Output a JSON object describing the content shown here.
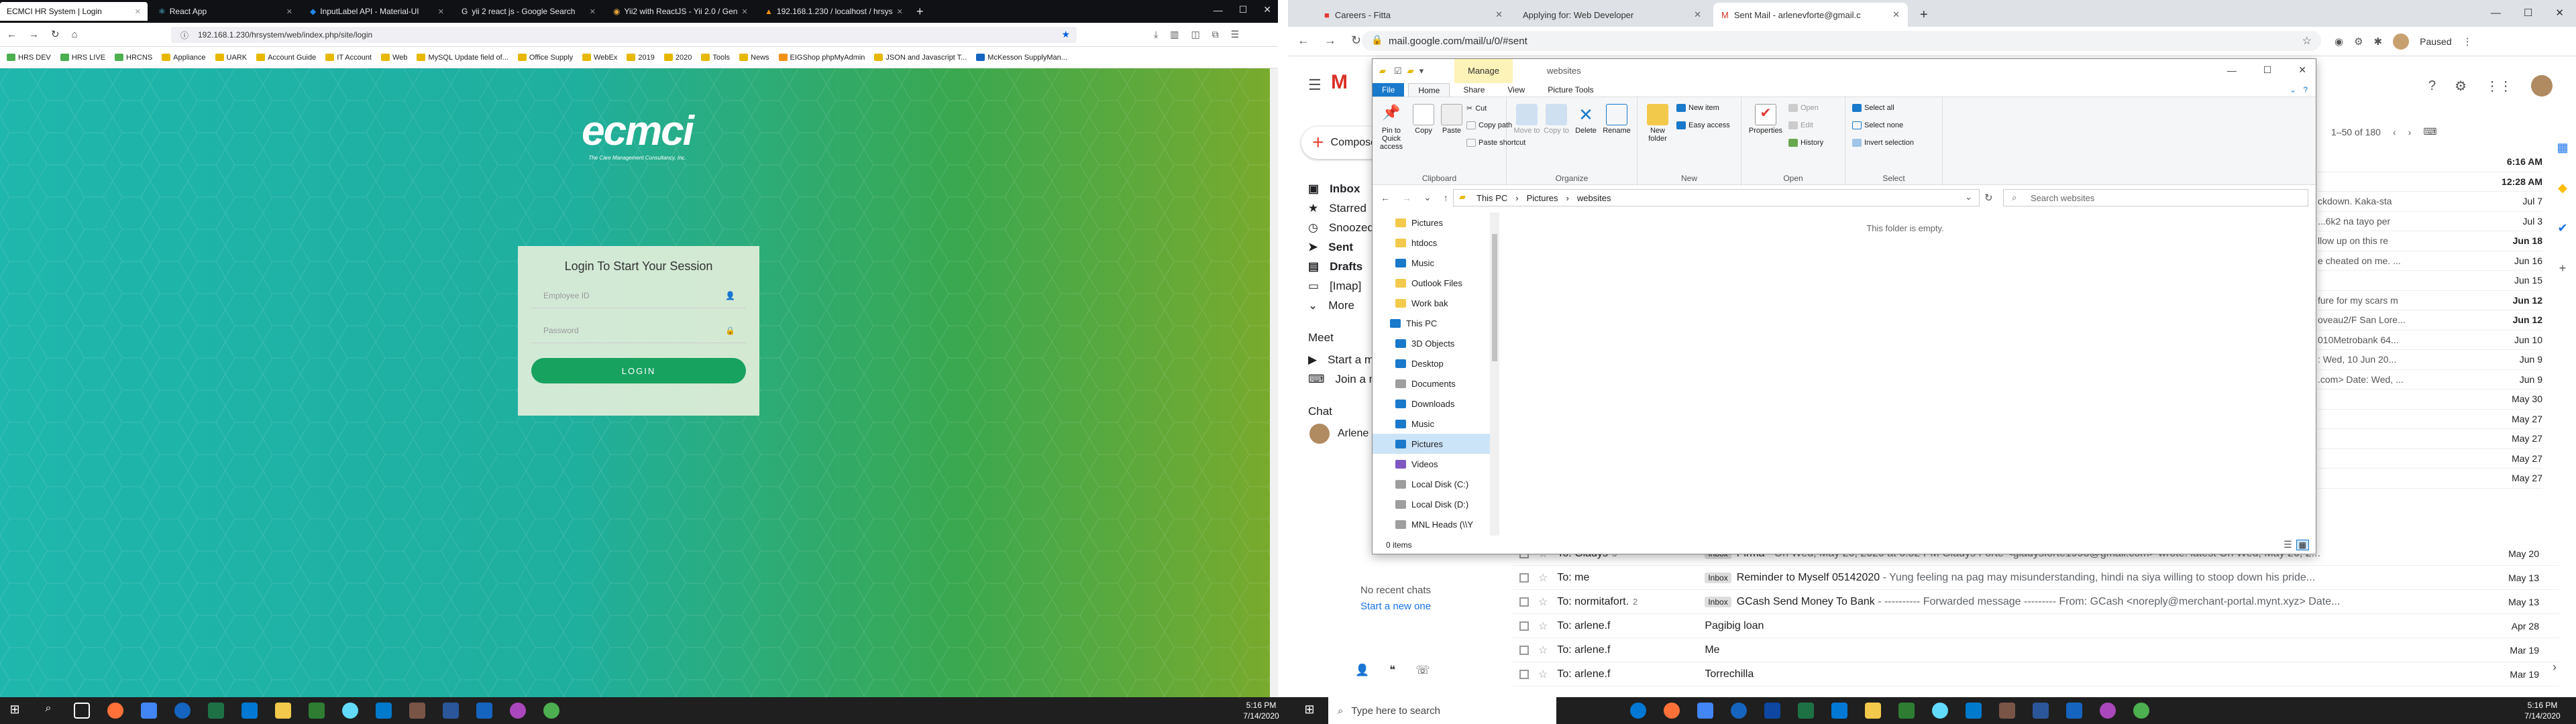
{
  "firefox": {
    "tabs": [
      {
        "label": "ECMCI HR System | Login",
        "active": true
      },
      {
        "label": "React App"
      },
      {
        "label": "InputLabel API - Material-UI"
      },
      {
        "label": "yii 2 react js - Google Search"
      },
      {
        "label": "Yii2 with ReactJS - Yii 2.0 / Gen"
      },
      {
        "label": "192.168.1.230 / localhost / hrsys"
      }
    ],
    "url": "192.168.1.230/hrsystem/web/index.php/site/login",
    "bookmarks": [
      "HRS DEV",
      "HRS LIVE",
      "HRCNS",
      "Appliance",
      "UARK",
      "Account Guide",
      "IT Account",
      "Web",
      "MySQL Update field of...",
      "Office Supply",
      "WebEx",
      "2019",
      "2020",
      "Tools",
      "News",
      "EIGShop phpMyAdmin",
      "JSON and Javascript T...",
      "McKesson SupplyMan..."
    ],
    "page": {
      "logo": "ecmci",
      "logo_tagline": "The Care Management Consultancy, Inc.",
      "login_title": "Login To Start Your Session",
      "employee_placeholder": "Employee ID",
      "password_placeholder": "Password",
      "login_button": "LOGIN"
    }
  },
  "chrome": {
    "tabs": [
      {
        "label": "Careers - Fitta"
      },
      {
        "label": "Applying for: Web Developer"
      },
      {
        "label": "Sent Mail - arlenevforte@gmail.c",
        "active": true
      }
    ],
    "url": "mail.google.com/mail/u/0/#sent",
    "profile_label": "Paused",
    "gmail": {
      "compose": "Compose",
      "nav": [
        "Inbox",
        "Starred",
        "Snoozed",
        "Sent",
        "Drafts",
        "[Imap]",
        "More"
      ],
      "meet_title": "Meet",
      "meet_items": [
        "Start a meeting",
        "Join a meeting"
      ],
      "chat_title": "Chat",
      "chat_user": "Arlene",
      "no_chats": "No recent chats",
      "start_new": "Start a new one",
      "pager": "1–50 of 180",
      "right_snippets": [
        {
          "text": "",
          "date": "6:16 AM"
        },
        {
          "text": "",
          "date": "12:28 AM"
        },
        {
          "text": "ckdown. Kaka-sta",
          "date": "Jul 7"
        },
        {
          "text": "...6k2 na tayo per",
          "date": "Jul 3"
        },
        {
          "text": "llow up on this re",
          "date": "Jun 18"
        },
        {
          "text": "e cheated on me. ...",
          "date": "Jun 16"
        },
        {
          "text": "",
          "date": "Jun 15"
        },
        {
          "text": "fure for my scars m",
          "date": "Jun 12"
        },
        {
          "text": "oveau2/F San Lore...",
          "date": "Jun 12"
        },
        {
          "text": "010Metrobank 64...",
          "date": "Jun 10"
        },
        {
          "text": ": Wed, 10 Jun 20...",
          "date": "Jun 9"
        },
        {
          "text": ".com> Date: Wed, ...",
          "date": "Jun 9"
        },
        {
          "text": "",
          "date": "May 30"
        },
        {
          "text": "",
          "date": "May 27"
        },
        {
          "text": "",
          "date": "May 27"
        },
        {
          "text": "",
          "date": "May 27"
        },
        {
          "text": "",
          "date": "May 27"
        }
      ],
      "rows": [
        {
          "to": "To: Gladys",
          "count": "3",
          "label": "Inbox",
          "subject": "Pirma",
          "snippet": " - On Wed, May 20, 2020 at 6:52 PM Gladys Forte <gladysforte1993@gmail.com> wrote: latest On Wed, May 20, 2...",
          "date": "May 20"
        },
        {
          "to": "To: me",
          "count": "",
          "label": "Inbox",
          "subject": "Reminder to Myself 05142020",
          "snippet": " - Yung feeling na pag may misunderstanding, hindi na siya willing to stoop down his pride...",
          "date": "May 13"
        },
        {
          "to": "To: normitafort.",
          "count": "2",
          "label": "Inbox",
          "subject": "GCash Send Money To Bank",
          "snippet": " - ---------- Forwarded message --------- From: GCash <noreply@merchant-portal.mynt.xyz> Date...",
          "date": "May 13"
        },
        {
          "to": "To: arlene.f",
          "count": "",
          "label": "",
          "subject": "Pagibig loan",
          "snippet": "",
          "date": "Apr 28"
        },
        {
          "to": "To: arlene.f",
          "count": "",
          "label": "",
          "subject": "Me",
          "snippet": "",
          "date": "Mar 19"
        },
        {
          "to": "To: arlene.f",
          "count": "",
          "label": "",
          "subject": "Torrechilla",
          "snippet": "",
          "date": "Mar 19"
        }
      ]
    }
  },
  "explorer": {
    "context_tab": "Manage",
    "title": "websites",
    "tabs": [
      "File",
      "Home",
      "Share",
      "View",
      "Picture Tools"
    ],
    "ribbon": {
      "clipboard": {
        "caption": "Clipboard",
        "pin": "Pin to Quick access",
        "copy": "Copy",
        "paste": "Paste",
        "cut": "Cut",
        "copy_path": "Copy path",
        "paste_shortcut": "Paste shortcut"
      },
      "organize": {
        "caption": "Organize",
        "move_to": "Move to",
        "copy_to": "Copy to",
        "delete": "Delete",
        "rename": "Rename"
      },
      "new": {
        "caption": "New",
        "new_folder": "New folder",
        "new_item": "New item",
        "easy_access": "Easy access"
      },
      "open": {
        "caption": "Open",
        "properties": "Properties",
        "open": "Open",
        "edit": "Edit",
        "history": "History"
      },
      "select": {
        "caption": "Select",
        "select_all": "Select all",
        "select_none": "Select none",
        "invert": "Invert selection"
      }
    },
    "path": [
      "This PC",
      "Pictures",
      "websites"
    ],
    "search_placeholder": "Search websites",
    "empty_text": "This folder is empty.",
    "nav_quick": [
      "Pictures",
      "htdocs",
      "Music",
      "Outlook Files",
      "Work bak"
    ],
    "nav_thispc_label": "This PC",
    "nav_pc": [
      "3D Objects",
      "Desktop",
      "Documents",
      "Downloads",
      "Music",
      "Pictures",
      "Videos",
      "Local Disk (C:)",
      "Local Disk (D:)",
      "MNL Heads (\\\\Y"
    ],
    "status": "0 items"
  },
  "taskbar": {
    "search_placeholder": "Type here to search",
    "time": "5:16 PM",
    "date": "7/14/2020"
  }
}
